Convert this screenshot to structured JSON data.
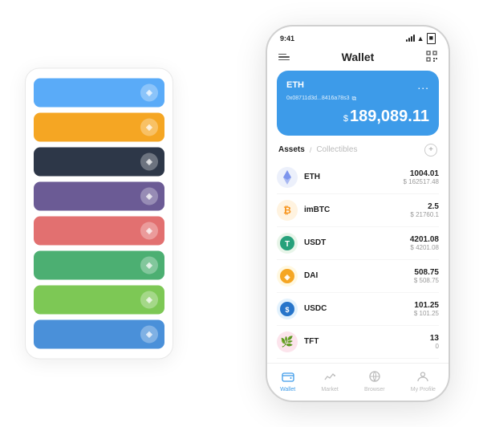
{
  "scene": {
    "background": "#ffffff"
  },
  "cardStack": {
    "cards": [
      {
        "id": "card-blue",
        "color": "card-blue",
        "icon": "◈"
      },
      {
        "id": "card-orange",
        "color": "card-orange",
        "icon": "◈"
      },
      {
        "id": "card-dark",
        "color": "card-dark",
        "icon": "◈"
      },
      {
        "id": "card-purple",
        "color": "card-purple",
        "icon": "◈"
      },
      {
        "id": "card-red",
        "color": "card-red",
        "icon": "◈"
      },
      {
        "id": "card-green",
        "color": "card-green",
        "icon": "◈"
      },
      {
        "id": "card-light-green",
        "color": "card-light-green",
        "icon": "◈"
      },
      {
        "id": "card-blue2",
        "color": "card-blue2",
        "icon": "◈"
      }
    ]
  },
  "phone": {
    "statusBar": {
      "time": "9:41",
      "signal": "●●●",
      "wifi": "WiFi",
      "battery": "□"
    },
    "header": {
      "title": "Wallet",
      "menuIcon": "menu",
      "scanIcon": "scan"
    },
    "walletCard": {
      "label": "ETH",
      "dots": "...",
      "address": "0x08711d3d...8416a78s3",
      "copyIcon": "⧉",
      "currencySymbol": "$",
      "amount": "189,089.11"
    },
    "assetsTabs": {
      "active": "Assets",
      "separator": "/",
      "inactive": "Collectibles",
      "addIcon": "+"
    },
    "assets": [
      {
        "icon": "ETH",
        "iconClass": "icon-eth",
        "name": "ETH",
        "amount": "1004.01",
        "usd": "$ 162517.48"
      },
      {
        "icon": "₿",
        "iconClass": "icon-imbtc",
        "name": "imBTC",
        "amount": "2.5",
        "usd": "$ 21760.1"
      },
      {
        "icon": "T",
        "iconClass": "icon-usdt",
        "name": "USDT",
        "amount": "4201.08",
        "usd": "$ 4201.08"
      },
      {
        "icon": "◈",
        "iconClass": "icon-dai",
        "name": "DAI",
        "amount": "508.75",
        "usd": "$ 508.75"
      },
      {
        "icon": "$",
        "iconClass": "icon-usdc",
        "name": "USDC",
        "amount": "101.25",
        "usd": "$ 101.25"
      },
      {
        "icon": "🌿",
        "iconClass": "icon-tft",
        "name": "TFT",
        "amount": "13",
        "usd": "0"
      }
    ],
    "bottomNav": [
      {
        "label": "Wallet",
        "icon": "◎",
        "active": true
      },
      {
        "label": "Market",
        "icon": "↗",
        "active": false
      },
      {
        "label": "Browser",
        "icon": "⊙",
        "active": false
      },
      {
        "label": "My Profile",
        "icon": "👤",
        "active": false
      }
    ]
  }
}
